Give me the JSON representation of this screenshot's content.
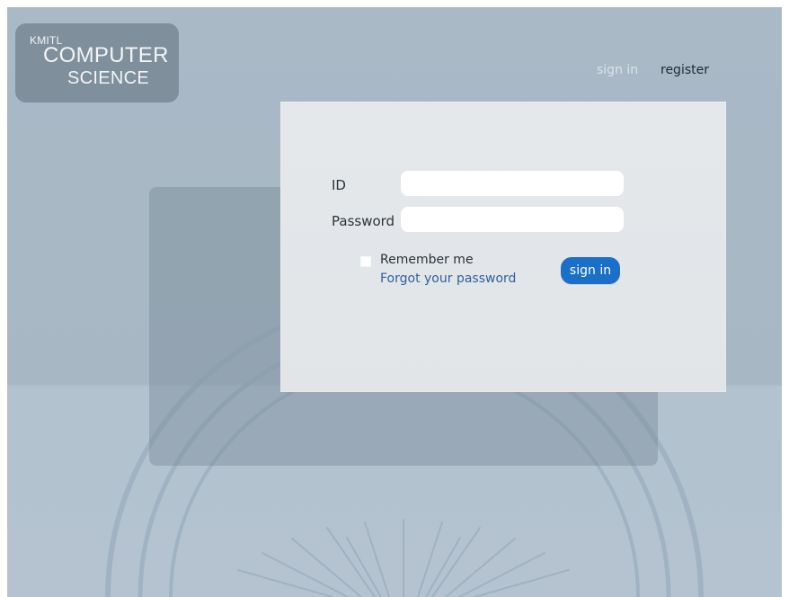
{
  "brand": {
    "line1": "KMITL",
    "line2": "COMPUTER",
    "line3": "SCIENCE"
  },
  "nav": {
    "sign_in": "sign in",
    "register": "register"
  },
  "form": {
    "id_label": "ID",
    "password_label": "Password",
    "id_value": "",
    "password_value": "",
    "remember_me": "Remember me",
    "forgot_password": "Forgot your password",
    "sign_in_button": "sign in"
  },
  "colors": {
    "background": "#a9b9c6",
    "panel": "#e1e5e8",
    "logo_box": "#7f8f9b",
    "primary_button": "#1a6fc8",
    "link": "#2f5f9e"
  }
}
